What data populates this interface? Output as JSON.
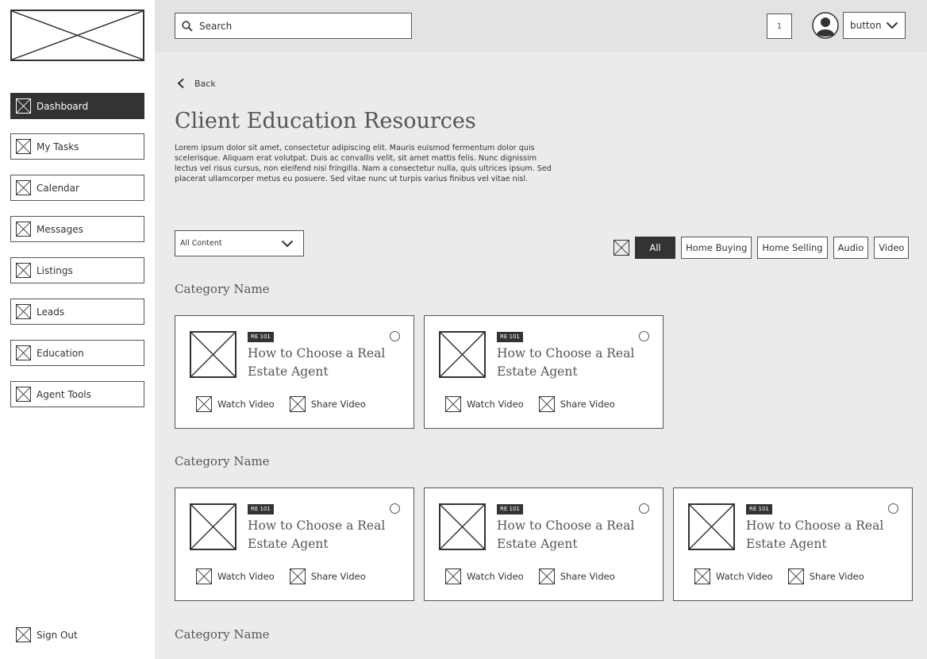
{
  "sidebar": {
    "items": [
      {
        "label": "Dashboard",
        "icon": "placeholder-icon",
        "active": true
      },
      {
        "label": "My Tasks",
        "icon": "placeholder-icon"
      },
      {
        "label": "Calendar",
        "icon": "placeholder-icon"
      },
      {
        "label": "Messages",
        "icon": "placeholder-icon"
      },
      {
        "label": "Listings",
        "icon": "placeholder-icon"
      },
      {
        "label": "Leads",
        "icon": "placeholder-icon"
      },
      {
        "label": "Education",
        "icon": "placeholder-icon"
      },
      {
        "label": "Agent Tools",
        "icon": "placeholder-icon"
      }
    ],
    "sign_out": "Sign Out"
  },
  "header": {
    "search_placeholder": "Search",
    "notification_count": "1",
    "user_button": "button"
  },
  "main": {
    "back": "Back",
    "title": "Client Education Resources",
    "description": "Lorem ipsum dolor sit amet, consectetur adipiscing elit. Mauris euismod fermentum dolor quis scelerisque. Aliquam erat volutpat. Duis ac convallis velit, sit amet mattis felis. Nunc dignissim lectus vel risus cursus, non eleifend nisi fringilla. Nam a consectetur nulla, quis ultrices ipsum. Sed placerat ullamcorper metus eu posuere. Sed vitae nunc ut turpis varius finibus vel vitae nisl.",
    "content_select": "All Content",
    "filters": [
      "All",
      "Home Buying",
      "Home Selling",
      "Audio",
      "Video"
    ],
    "active_filter": "All",
    "categories": [
      {
        "name": "Category Name",
        "cards": [
          {
            "badge": "RE 101",
            "title": "How to Choose a Real Estate Agent",
            "watch": "Watch Video",
            "share": "Share Video"
          },
          {
            "badge": "RE 101",
            "title": "How to Choose a Real Estate Agent",
            "watch": "Watch Video",
            "share": "Share Video"
          }
        ]
      },
      {
        "name": "Category Name",
        "cards": [
          {
            "badge": "RE 101",
            "title": "How to Choose a Real Estate Agent",
            "watch": "Watch Video",
            "share": "Share Video"
          },
          {
            "badge": "RE 101",
            "title": "How to Choose a Real Estate Agent",
            "watch": "Watch Video",
            "share": "Share Video"
          },
          {
            "badge": "RE 101",
            "title": "How to Choose a Real Estate Agent",
            "watch": "Watch Video",
            "share": "Share Video"
          }
        ]
      },
      {
        "name": "Category Name",
        "cards": []
      }
    ]
  }
}
